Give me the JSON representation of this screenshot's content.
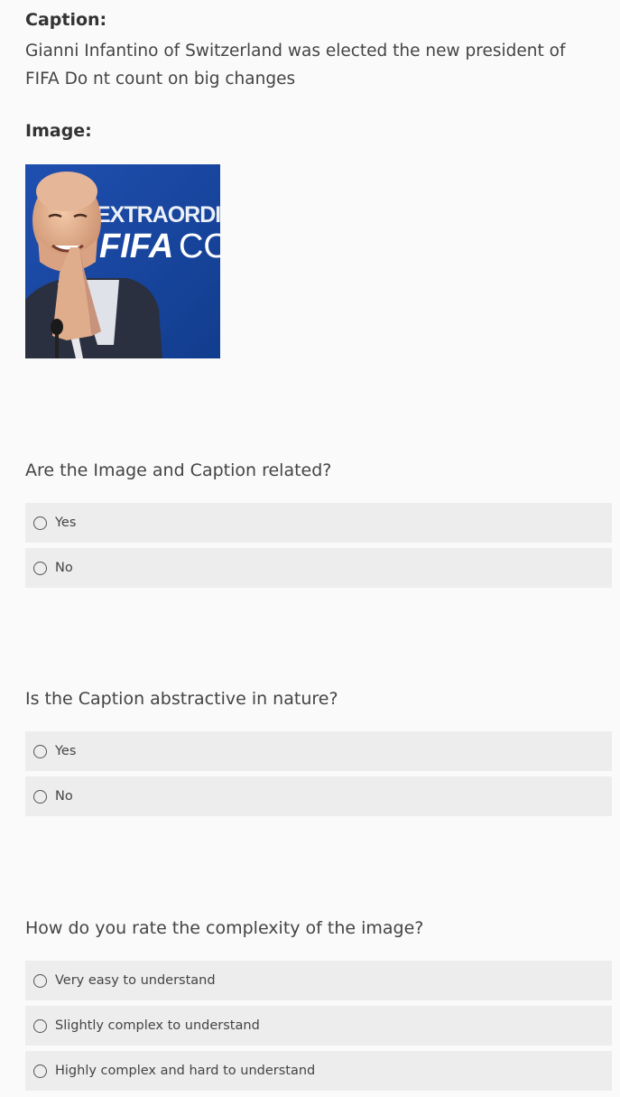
{
  "caption": {
    "heading": "Caption:",
    "text": "Gianni Infantino of Switzerland was elected the new president of FIFA Do nt count on big changes"
  },
  "image": {
    "heading": "Image:",
    "backdrop_text_line1": "EXTRAORDIN",
    "backdrop_text_line2": "FIFA",
    "backdrop_text_line2_suffix": "CO"
  },
  "questions": [
    {
      "label": "Are the Image and Caption related?",
      "options": [
        "Yes",
        "No"
      ]
    },
    {
      "label": "Is the Caption abstractive in nature?",
      "options": [
        "Yes",
        "No"
      ]
    },
    {
      "label": "How do you rate the complexity of the image?",
      "options": [
        "Very easy to understand",
        "Slightly complex to understand",
        "Highly complex and hard to understand"
      ]
    }
  ]
}
